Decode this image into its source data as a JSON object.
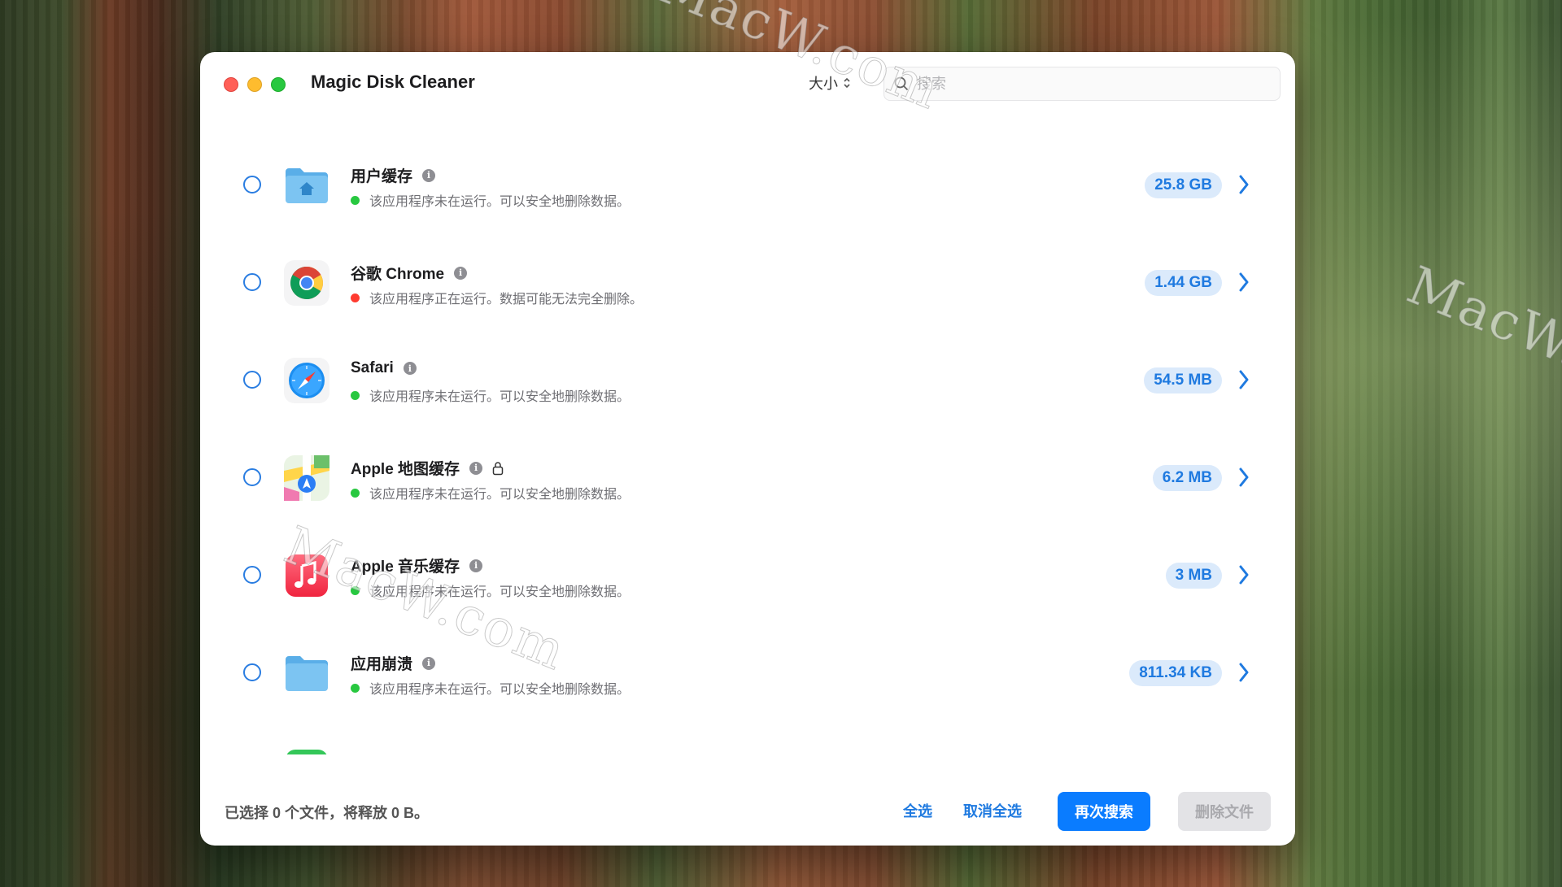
{
  "window": {
    "title": "Magic Disk Cleaner",
    "sort_label": "大小",
    "search_placeholder": "搜索"
  },
  "items": [
    {
      "name": "用户缓存",
      "icon": "home-folder-icon",
      "status": "该应用程序未在运行。可以安全地删除数据。",
      "status_color": "green",
      "size": "25.8 GB",
      "locked": false
    },
    {
      "name": "谷歌 Chrome",
      "icon": "chrome-icon",
      "status": "该应用程序正在运行。数据可能无法完全删除。",
      "status_color": "red",
      "size": "1.44 GB",
      "locked": false
    },
    {
      "name": "Safari",
      "icon": "safari-icon",
      "status": "该应用程序未在运行。可以安全地删除数据。",
      "status_color": "green",
      "size": "54.5 MB",
      "locked": false
    },
    {
      "name": "Apple 地图缓存",
      "icon": "maps-icon",
      "status": "该应用程序未在运行。可以安全地删除数据。",
      "status_color": "green",
      "size": "6.2 MB",
      "locked": true
    },
    {
      "name": "Apple 音乐缓存",
      "icon": "music-icon",
      "status": "该应用程序未在运行。可以安全地删除数据。",
      "status_color": "green",
      "size": "3 MB",
      "locked": false
    },
    {
      "name": "应用崩溃",
      "icon": "folder-icon",
      "status": "该应用程序未在运行。可以安全地删除数据。",
      "status_color": "green",
      "size": "811.34 KB",
      "locked": false
    }
  ],
  "footer": {
    "selection_status": "已选择 0 个文件，将释放 0 B。",
    "select_all": "全选",
    "deselect_all": "取消全选",
    "search_again": "再次搜索",
    "delete_files": "删除文件"
  },
  "watermark": "MacW.com",
  "colors": {
    "accent": "#0a7cff",
    "badge_bg": "#dbeafb",
    "badge_text": "#1f7ae0"
  }
}
